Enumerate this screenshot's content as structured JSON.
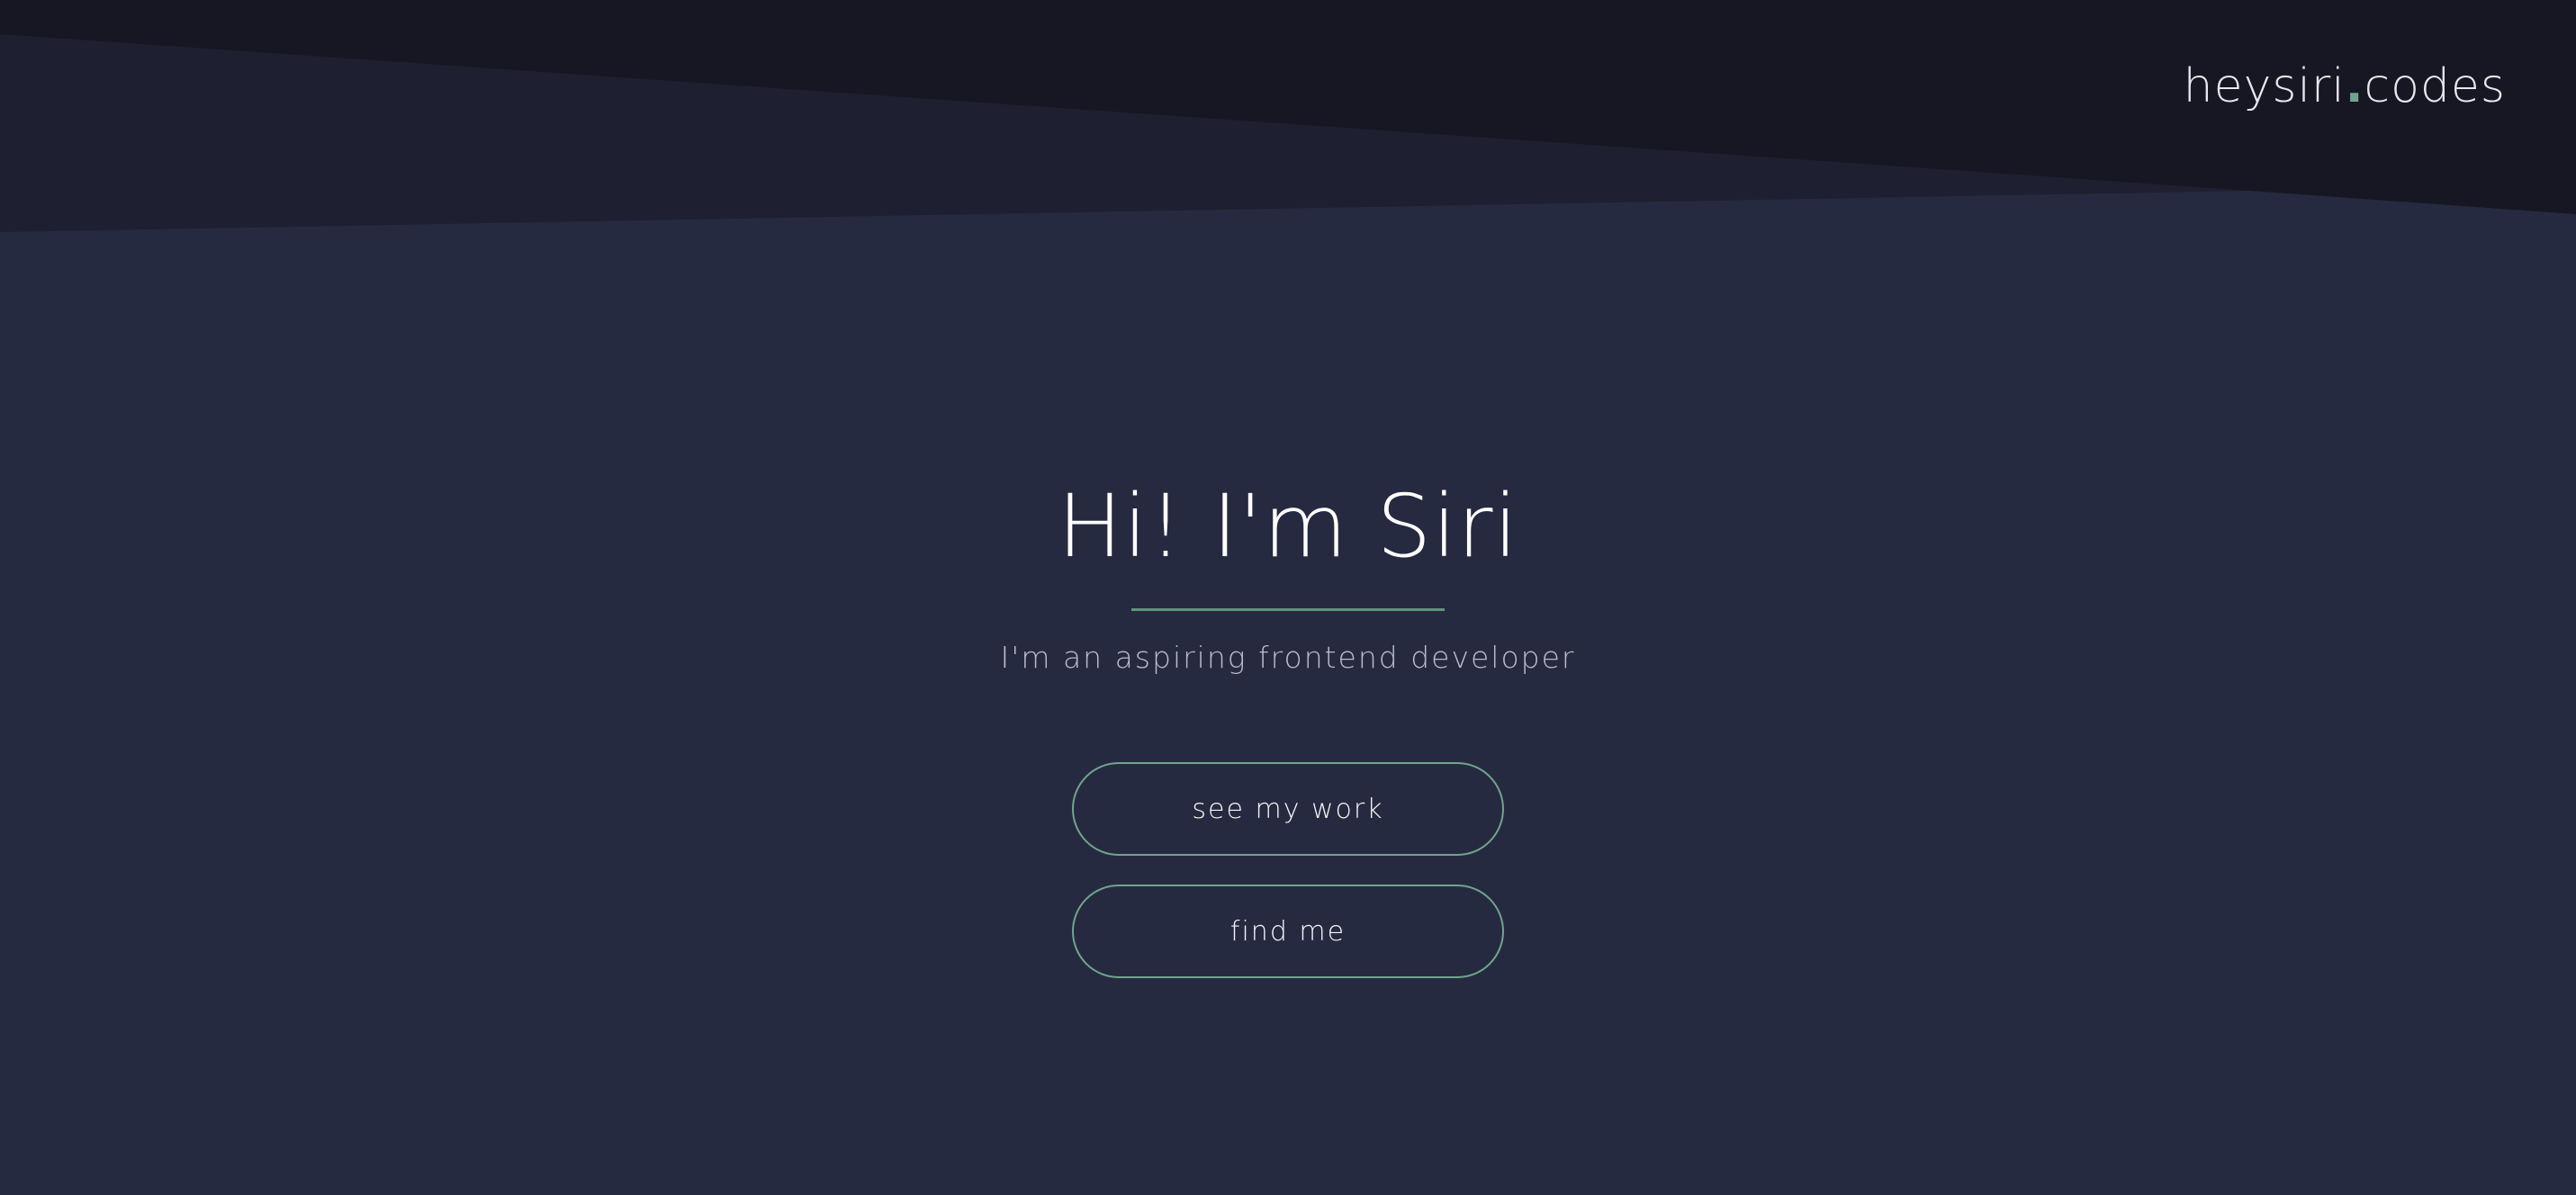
{
  "header": {
    "logo_name": "heysiri",
    "logo_dot": ".",
    "logo_tld": "codes"
  },
  "hero": {
    "title": "Hi! I'm Siri",
    "subtitle": "I'm an aspiring frontend developer"
  },
  "actions": {
    "see_work_label": "see my work",
    "find_me_label": "find me"
  },
  "colors": {
    "background": "#262a40",
    "header_dark": "#161722",
    "header_mid": "#1e2031",
    "accent": "#6fa58c",
    "text_primary": "#ffffff",
    "text_secondary": "#b9bccb"
  }
}
